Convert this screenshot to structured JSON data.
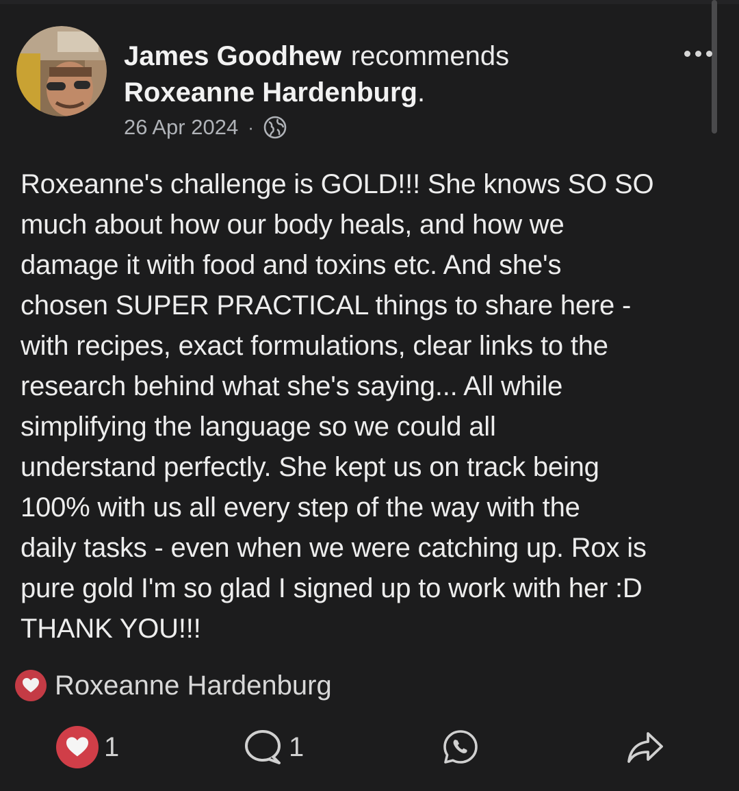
{
  "post": {
    "author": "James Goodhew",
    "verb": "recommends",
    "target": "Roxeanne Hardenburg",
    "target_suffix": ".",
    "date": "26 Apr 2024",
    "meta_separator": "·",
    "privacy_icon": "globe-icon",
    "body": "Roxeanne's challenge is GOLD!!! She knows SO SO\nmuch about how our body heals, and how we\ndamage it with food and toxins etc. And she's\nchosen  SUPER PRACTICAL things to share here -\nwith recipes, exact formulations, clear links to the\nresearch behind what she's saying... All while\nsimplifying the language so we could all\nunderstand perfectly. She kept us on track being\n100% with us all every step of the way with the\ndaily tasks - even when we were catching up. Rox is\npure gold I'm so glad I signed up to work with her :D\nTHANK YOU!!!"
  },
  "reactions": {
    "icon": "heart-icon",
    "reactor_name": "Roxeanne Hardenburg"
  },
  "actions": {
    "like_count": "1",
    "comment_count": "1",
    "like_icon": "heart-icon",
    "comment_icon": "comment-bubble-icon",
    "whatsapp_icon": "whatsapp-icon",
    "share_icon": "share-arrow-icon"
  },
  "colors": {
    "background": "#1c1c1d",
    "heart_red": "#d03e48",
    "secondary_text": "#b0b3b8"
  }
}
